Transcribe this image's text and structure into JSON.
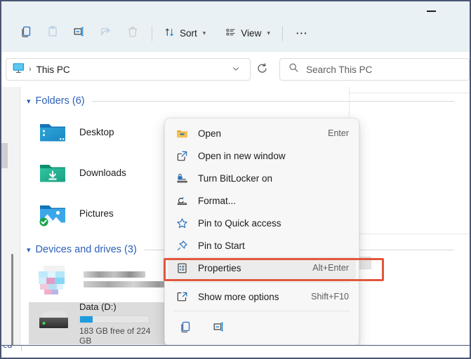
{
  "window": {
    "minimize_label": "Minimize"
  },
  "toolbar": {
    "buttons": [
      {
        "name": "copy-icon",
        "label": "Copy",
        "enabled": true
      },
      {
        "name": "paste-icon",
        "label": "Paste",
        "enabled": false
      },
      {
        "name": "rename-icon",
        "label": "Rename",
        "enabled": true
      },
      {
        "name": "share-icon",
        "label": "Share",
        "enabled": false
      },
      {
        "name": "delete-icon",
        "label": "Delete",
        "enabled": false
      }
    ],
    "sort_label": "Sort",
    "view_label": "View",
    "more_label": "See more"
  },
  "address": {
    "icon": "this-pc-icon",
    "crumb": "This PC",
    "separator": "›",
    "dropdown": "⌄",
    "refresh": "⟳"
  },
  "search": {
    "icon": "search-icon",
    "placeholder": "Search This PC"
  },
  "main": {
    "groups": [
      {
        "title": "Folders (6)",
        "items": [
          {
            "name": "Desktop",
            "icon": "desktop-folder-icon"
          },
          {
            "name": "Downloads",
            "icon": "downloads-folder-icon"
          },
          {
            "name": "Pictures",
            "icon": "pictures-folder-icon",
            "badge": "sync-ok-badge"
          }
        ]
      },
      {
        "title": "Devices and drives (3)",
        "items": [
          {
            "name": "",
            "icon": "blurred-drive-icon",
            "redacted": true
          },
          {
            "name": "Data (D:)",
            "icon": "hard-drive-icon",
            "capacity_text": "183 GB free of 224 GB",
            "used_percent": 18,
            "selected": true
          }
        ]
      }
    ]
  },
  "context_menu": {
    "items": [
      {
        "label": "Open",
        "accel": "Enter",
        "icon": "folder-open-icon",
        "highlighted": false
      },
      {
        "label": "Open in new window",
        "accel": "",
        "icon": "open-new-window-icon",
        "highlighted": false
      },
      {
        "label": "Turn BitLocker on",
        "accel": "",
        "icon": "bitlocker-lock-icon",
        "highlighted": false
      },
      {
        "label": "Format...",
        "accel": "",
        "icon": "format-drive-icon",
        "highlighted": false
      },
      {
        "label": "Pin to Quick access",
        "accel": "",
        "icon": "star-icon",
        "highlighted": false
      },
      {
        "label": "Pin to Start",
        "accel": "",
        "icon": "pin-icon",
        "highlighted": false
      },
      {
        "label": "Properties",
        "accel": "Alt+Enter",
        "icon": "properties-icon",
        "highlighted": true
      },
      {
        "label": "Show more options",
        "accel": "Shift+F10",
        "icon": "show-more-options-icon",
        "highlighted": false
      }
    ],
    "footer_icons": [
      {
        "name": "copy-icon",
        "label": "Copy"
      },
      {
        "name": "rename-icon",
        "label": "Rename"
      }
    ]
  },
  "annotation": {
    "color": "#e2563c",
    "target": "Properties"
  },
  "statusbar": {
    "text": "ed"
  },
  "colors": {
    "accent_blue": "#2b5fb8",
    "drive_bar": "#1f9cdf",
    "toolbar_bg": "#eaf1f4",
    "annotation_red": "#e2563c",
    "window_border": "#4a5572"
  }
}
